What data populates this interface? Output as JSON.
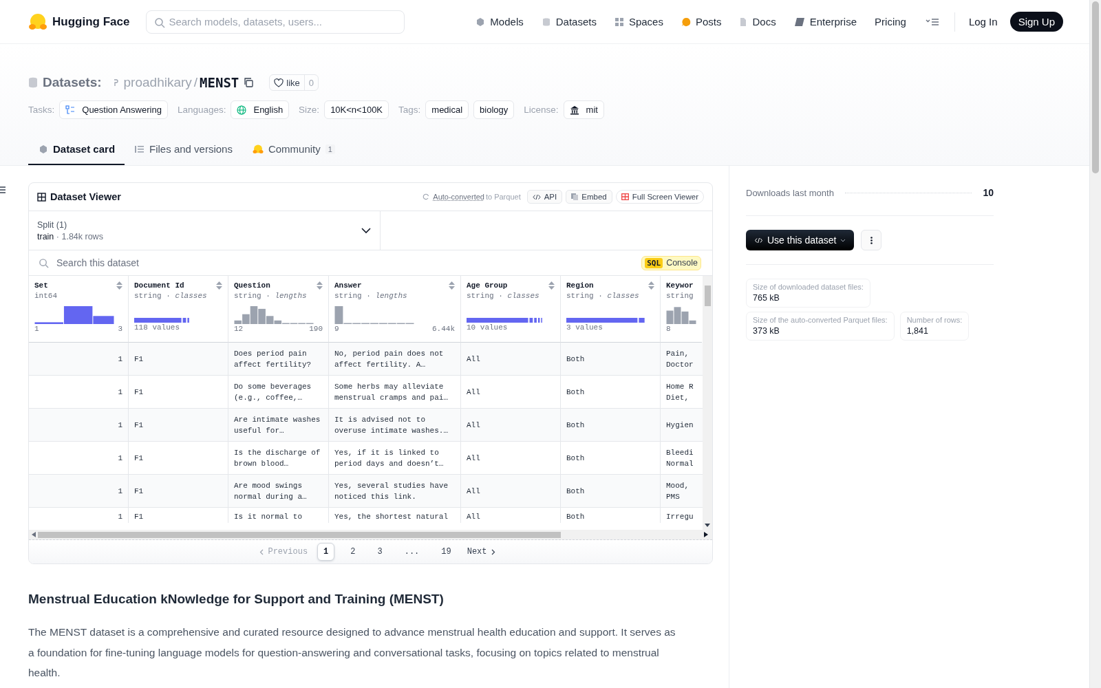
{
  "nav": {
    "logo": "Hugging Face",
    "search_placeholder": "Search models, datasets, users...",
    "links": [
      {
        "label": "Models"
      },
      {
        "label": "Datasets"
      },
      {
        "label": "Spaces"
      },
      {
        "label": "Posts"
      },
      {
        "label": "Docs"
      },
      {
        "label": "Enterprise"
      },
      {
        "label": "Pricing"
      }
    ],
    "login": "Log In",
    "signup": "Sign Up"
  },
  "header": {
    "section": "Datasets:",
    "owner": "proadhikary",
    "separator": "/",
    "name": "MENST",
    "like": "like",
    "like_count": "0",
    "meta": [
      {
        "label": "Tasks:",
        "tags": [
          "Question Answering"
        ]
      },
      {
        "label": "Languages:",
        "tags": [
          "English"
        ]
      },
      {
        "label": "Size:",
        "tags": [
          "10K<n<100K"
        ]
      },
      {
        "label": "Tags:",
        "tags": [
          "medical",
          "biology"
        ]
      },
      {
        "label": "License:",
        "tags": [
          "mit"
        ]
      }
    ]
  },
  "tabs": [
    {
      "label": "Dataset card",
      "selected": true
    },
    {
      "label": "Files and versions",
      "selected": false
    },
    {
      "label": "Community",
      "selected": false,
      "count": "1"
    }
  ],
  "viewer": {
    "title": "Dataset Viewer",
    "converted_link": "Auto-converted",
    "converted_rest": "to Parquet",
    "buttons": [
      "API",
      "Embed",
      "Full Screen Viewer"
    ],
    "split_label": "Split (1)",
    "split_value": "train",
    "split_sep": "·",
    "split_rows": "1.84k rows",
    "search_placeholder": "Search this dataset",
    "sql_badge": "SQL",
    "sql_label": "Console",
    "columns": [
      {
        "name": "Set",
        "type": "int64",
        "kind": "histogram",
        "min": "1",
        "max": "3"
      },
      {
        "name": "Document Id",
        "type": "string · *classes*",
        "kind": "classes",
        "summary": "118 values"
      },
      {
        "name": "Question",
        "type": "string · *lengths*",
        "kind": "histogram",
        "min": "12",
        "max": "190"
      },
      {
        "name": "Answer",
        "type": "string · *lengths*",
        "kind": "histogram",
        "min": "9",
        "max": "6.44k"
      },
      {
        "name": "Age Group",
        "type": "string · *classes*",
        "kind": "classes",
        "summary": "10 values"
      },
      {
        "name": "Region",
        "type": "string · *classes*",
        "kind": "classes",
        "summary": "3 values"
      },
      {
        "name": "Keywor",
        "type": "string",
        "kind": "histogram",
        "min": "8"
      }
    ],
    "rows": [
      [
        "1",
        "F1",
        "Does period pain affect fertility?",
        "No, period pain does not affect fertility. A…",
        "All",
        "Both",
        "Pain,\nDoctor"
      ],
      [
        "1",
        "F1",
        "Do some beverages (e.g., coffee,…",
        "Some herbs may alleviate menstrual cramps and pai…",
        "All",
        "Both",
        "Home R\nDiet,"
      ],
      [
        "1",
        "F1",
        "Are intimate washes useful for…",
        "It is advised not to overuse intimate washes.…",
        "All",
        "Both",
        "Hygien"
      ],
      [
        "1",
        "F1",
        "Is the discharge of brown blood…",
        "Yes, if it is linked to period days and doesn’t…",
        "All",
        "Both",
        "Bleedi\nNormal"
      ],
      [
        "1",
        "F1",
        "Are mood swings normal during a…",
        "Yes, several studies have noticed this link.",
        "All",
        "Both",
        "Mood,\nPMS"
      ],
      [
        "1",
        "F1",
        "Is it normal to",
        "Yes, the shortest natural",
        "All",
        "Both",
        "Irregu"
      ]
    ],
    "pagination": {
      "previous": "Previous",
      "previous_disabled": true,
      "pages": [
        {
          "label": "1",
          "kind": "page",
          "selected": true
        },
        {
          "label": "2",
          "kind": "page",
          "selected": false
        },
        {
          "label": "3",
          "kind": "page",
          "selected": false
        },
        {
          "label": "...",
          "kind": "gap"
        },
        {
          "label": "19",
          "kind": "page",
          "selected": false
        }
      ],
      "next": "Next"
    }
  },
  "card": {
    "heading": "Menstrual Education kNowledge for Support and Training (MENST)",
    "paragraph": "The MENST dataset is a comprehensive and curated resource designed to advance menstrual health education and support. It serves as a foundation for fine-tuning language models for question-answering and conversational tasks, focusing on topics related to menstrual health."
  },
  "sidebar": {
    "downloads_label": "Downloads last month",
    "downloads_value": "10",
    "use_button": "Use this dataset",
    "stats": [
      {
        "label": "Size of downloaded dataset files:",
        "value": "765 kB"
      },
      {
        "label": "Size of the auto-converted Parquet files:",
        "value": "373 kB"
      },
      {
        "label": "Number of rows:",
        "value": "1,841"
      }
    ]
  }
}
